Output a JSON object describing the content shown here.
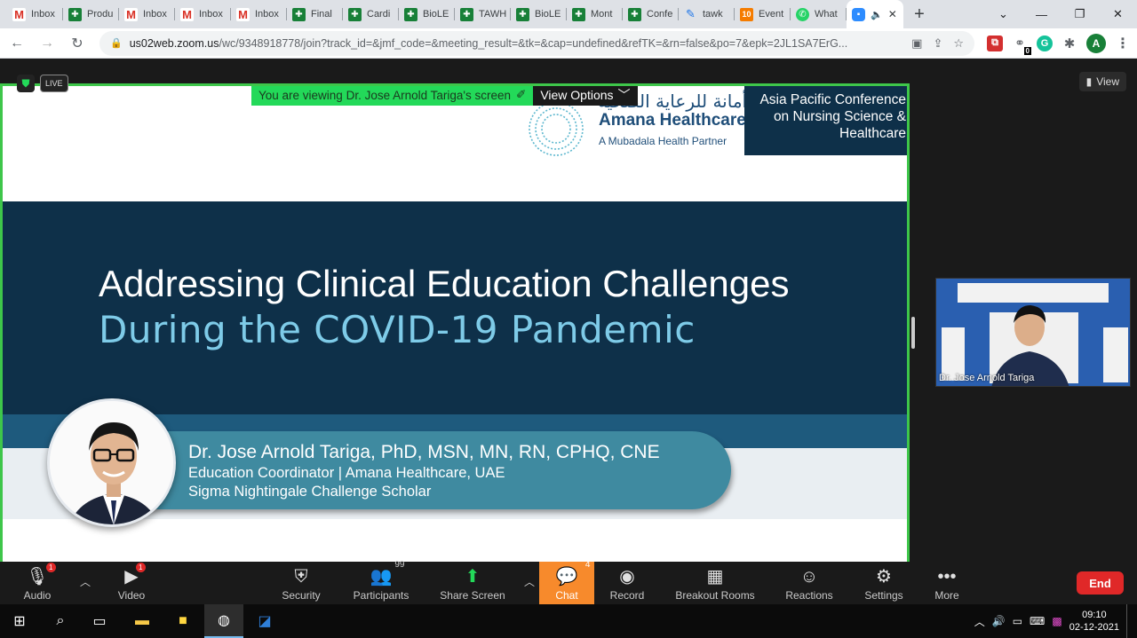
{
  "browser": {
    "tabs": [
      {
        "label": "Inbox",
        "icon": "gmail"
      },
      {
        "label": "Produ",
        "icon": "sheets"
      },
      {
        "label": "Inbox",
        "icon": "gmail"
      },
      {
        "label": "Inbox",
        "icon": "gmail"
      },
      {
        "label": "Inbox",
        "icon": "gmail"
      },
      {
        "label": "Final",
        "icon": "sheets"
      },
      {
        "label": "Cardi",
        "icon": "sheets"
      },
      {
        "label": "BioLE",
        "icon": "sheets"
      },
      {
        "label": "TAWH",
        "icon": "sheets"
      },
      {
        "label": "BioLE",
        "icon": "sheets"
      },
      {
        "label": "Mont",
        "icon": "sheets"
      },
      {
        "label": "Confe",
        "icon": "sheets"
      },
      {
        "label": "tawk",
        "icon": "tawk"
      },
      {
        "label": "Event",
        "icon": "ten"
      },
      {
        "label": "What",
        "icon": "whatsapp"
      }
    ],
    "active_tab_icon": "zoom",
    "url_host": "us02web.zoom.us",
    "url_rest": "/wc/9348918778/join?track_id=&jmf_code=&meeting_result=&tk=&cap=undefined&refTK=&rn=false&po=7&epk=2JL1SA7ErG...",
    "profile_initial": "A",
    "ext_badge": "0"
  },
  "zoom": {
    "live_label": "LIVE",
    "view_button": "View",
    "viewing_banner": "You are viewing Dr. Jose Arnold Tariga's screen",
    "view_options": "View Options",
    "slide": {
      "arabic_name": "أمانة للرعاية الصحية",
      "brand": "Amana Healthcare",
      "partner": "A Mubadala Health Partner",
      "conference_line1": "Asia Pacific Conference",
      "conference_line2": "on Nursing Science &",
      "conference_line3": "Healthcare",
      "title_line1": "Addressing Clinical Education Challenges",
      "title_line2": "During the COVID-19 Pandemic",
      "speaker_name": "Dr. Jose Arnold Tariga, PhD, MSN, MN, RN, CPHQ, CNE",
      "speaker_role": "Education Coordinator | Amana Healthcare, UAE",
      "speaker_award": "Sigma Nightingale Challenge Scholar"
    },
    "participant_thumb_name": "Dr. Jose Arnold Tariga",
    "toolbar": {
      "audio": "Audio",
      "video": "Video",
      "security": "Security",
      "participants": "Participants",
      "participants_count": "99",
      "share_screen": "Share Screen",
      "chat": "Chat",
      "chat_count": "4",
      "record": "Record",
      "breakout_rooms": "Breakout Rooms",
      "reactions": "Reactions",
      "settings": "Settings",
      "more": "More",
      "end": "End",
      "audio_badge": "1",
      "video_badge": "1"
    }
  },
  "taskbar": {
    "time": "09:10",
    "date": "02-12-2021"
  },
  "colors": {
    "share_border": "#3ec64a",
    "slide_navy": "#0e3049",
    "chat_orange": "#f78a2c",
    "end_red": "#e02828"
  }
}
